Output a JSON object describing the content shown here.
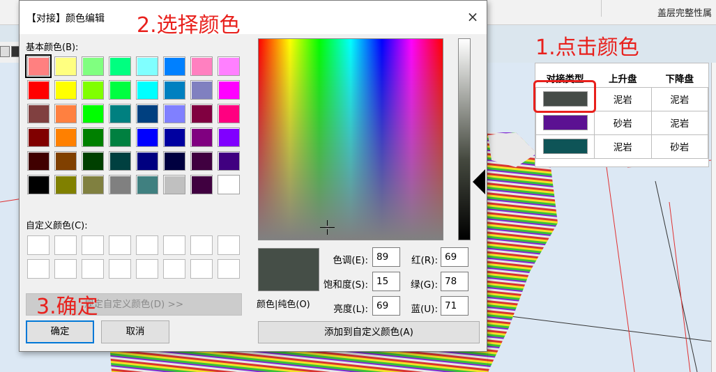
{
  "background": {
    "window_title": "盖层完整性属",
    "legend": {
      "headers": [
        "对接类型",
        "上升盘",
        "下降盘"
      ],
      "rows": [
        {
          "color": "#454b47",
          "up": "泥岩",
          "down": "泥岩"
        },
        {
          "color": "#5b1192",
          "up": "砂岩",
          "down": "泥岩"
        },
        {
          "color": "#0e5457",
          "up": "泥岩",
          "down": "砂岩"
        }
      ]
    }
  },
  "annotations": {
    "step1": "1.点击颜色",
    "step2": "2.选择颜色",
    "step3": "3.确定",
    "color": "#e8201c"
  },
  "dialog": {
    "title": "【对接】颜色编辑",
    "close_icon": "×",
    "basic_colors_label": "基本颜色(B):",
    "custom_colors_label": "自定义颜色(C):",
    "basic_colors": [
      "#ff8080",
      "#ffff80",
      "#80ff80",
      "#00ff80",
      "#80ffff",
      "#0080ff",
      "#ff80c0",
      "#ff80ff",
      "#ff0000",
      "#ffff00",
      "#80ff00",
      "#00ff40",
      "#00ffff",
      "#0080c0",
      "#8080c0",
      "#ff00ff",
      "#804040",
      "#ff8040",
      "#00ff00",
      "#008080",
      "#004080",
      "#8080ff",
      "#800040",
      "#ff0080",
      "#800000",
      "#ff8000",
      "#008000",
      "#008040",
      "#0000ff",
      "#0000a0",
      "#800080",
      "#8000ff",
      "#400000",
      "#804000",
      "#004000",
      "#004040",
      "#000080",
      "#000040",
      "#400040",
      "#400080",
      "#000000",
      "#808000",
      "#808040",
      "#808080",
      "#408080",
      "#c0c0c0",
      "#400040",
      "#ffffff"
    ],
    "selected_index": 0,
    "custom_colors_count": 16,
    "define_custom_label": "规定自定义颜色(D) >>",
    "ok_label": "确定",
    "cancel_label": "取消",
    "add_custom_label": "添加到自定义颜色(A)",
    "preview_label": "颜色|纯色(O)",
    "preview_color": "#454e47",
    "fields": {
      "hue": {
        "label": "色调(E):",
        "value": "89"
      },
      "sat": {
        "label": "饱和度(S):",
        "value": "15"
      },
      "lum": {
        "label": "亮度(L):",
        "value": "69"
      },
      "red": {
        "label": "红(R):",
        "value": "69"
      },
      "green": {
        "label": "绿(G):",
        "value": "78"
      },
      "blue": {
        "label": "蓝(U):",
        "value": "71"
      }
    }
  }
}
